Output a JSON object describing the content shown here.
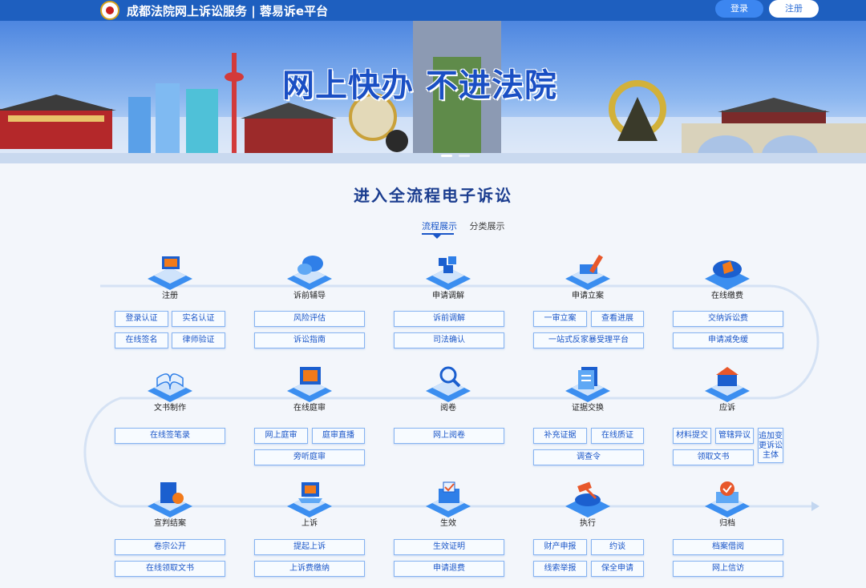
{
  "header": {
    "site_title": "成都法院网上诉讼服务 | 蓉易诉e平台",
    "login_label": "登录",
    "register_label": "注册"
  },
  "banner": {
    "slogan": "网上快办 不进法院"
  },
  "main": {
    "section_title": "进入全流程电子诉讼",
    "tabs": [
      {
        "label": "流程展示",
        "active": true
      },
      {
        "label": "分类展示",
        "active": false
      }
    ],
    "stages": [
      {
        "label": "注册",
        "icon": "computer-icon"
      },
      {
        "label": "诉前辅导",
        "icon": "chat-bubble-icon"
      },
      {
        "label": "申请调解",
        "icon": "puzzle-icon"
      },
      {
        "label": "申请立案",
        "icon": "pen-icon"
      },
      {
        "label": "在线缴费",
        "icon": "payment-icon"
      },
      {
        "label": "文书制作",
        "icon": "book-icon"
      },
      {
        "label": "在线庭审",
        "icon": "court-screen-icon"
      },
      {
        "label": "阅卷",
        "icon": "magnifier-icon"
      },
      {
        "label": "证据交换",
        "icon": "document-stack-icon"
      },
      {
        "label": "应诉",
        "icon": "building-icon"
      },
      {
        "label": "宣判结案",
        "icon": "folder-check-icon"
      },
      {
        "label": "上诉",
        "icon": "laptop-icon"
      },
      {
        "label": "生效",
        "icon": "ballot-box-icon"
      },
      {
        "label": "执行",
        "icon": "gavel-icon"
      },
      {
        "label": "归档",
        "icon": "archive-check-icon"
      }
    ],
    "buttons": {
      "s1": [
        "登录认证",
        "实名认证",
        "在线签名",
        "律师验证"
      ],
      "s2": [
        "风险评估",
        "诉讼指南"
      ],
      "s3": [
        "诉前调解",
        "司法确认"
      ],
      "s4": [
        "一审立案",
        "查看进展",
        "一站式反家暴受理平台"
      ],
      "s5": [
        "交纳诉讼费",
        "申请减免缓"
      ],
      "s6": [
        "在线签笔录"
      ],
      "s7": [
        "网上庭审",
        "庭审直播",
        "旁听庭审"
      ],
      "s8": [
        "网上阅卷"
      ],
      "s9": [
        "补充证据",
        "在线质证",
        "调查令"
      ],
      "s10": [
        "材料提交",
        "管辖异议",
        "追加变更诉讼主体",
        "领取文书"
      ],
      "s11": [
        "卷宗公开",
        "在线领取文书"
      ],
      "s12": [
        "提起上诉",
        "上诉费缴纳"
      ],
      "s13": [
        "生效证明",
        "申请退费"
      ],
      "s14": [
        "财产申报",
        "约谈",
        "线索举报",
        "保全申请"
      ],
      "s15": [
        "档案借阅",
        "网上信访"
      ]
    }
  },
  "colors": {
    "brand_blue": "#1e5fbf",
    "accent": "#1a56c8",
    "button_border": "#86b3f1"
  }
}
